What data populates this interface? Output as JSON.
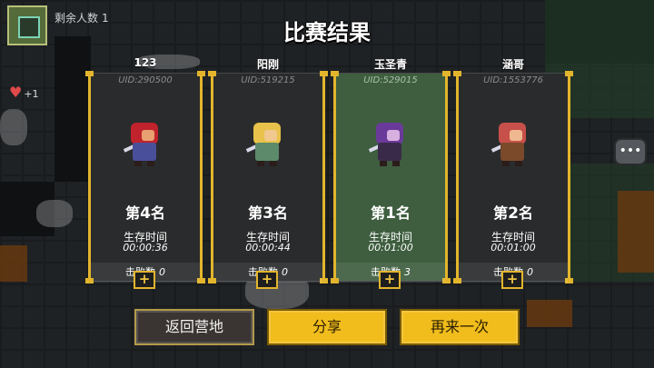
{
  "hud": {
    "remaining_label": "剩余人数",
    "remaining_count": "1",
    "heart_value": "+1",
    "chat_icon": "chat-bubble-icon"
  },
  "title": "比赛结果",
  "players": [
    {
      "name": "123",
      "uid": "UID:290500",
      "rank_prefix": "第",
      "rank": "4",
      "rank_suffix": "名",
      "survival_label": "生存时间",
      "survival_time": "00:00:36",
      "kills_label": "击败数",
      "kills": "0",
      "winner": false,
      "colors": {
        "head": "#c0232b",
        "face": "#e8a070",
        "body": "#4a4f9a"
      }
    },
    {
      "name": "阳刚",
      "uid": "UID:519215",
      "rank_prefix": "第",
      "rank": "3",
      "rank_suffix": "名",
      "survival_label": "生存时间",
      "survival_time": "00:00:44",
      "kills_label": "击败数",
      "kills": "0",
      "winner": false,
      "colors": {
        "head": "#e8c24a",
        "face": "#f0c890",
        "body": "#5c8a6a"
      }
    },
    {
      "name": "玉圣青",
      "uid": "UID:529015",
      "rank_prefix": "第",
      "rank": "1",
      "rank_suffix": "名",
      "survival_label": "生存时间",
      "survival_time": "00:01:00",
      "kills_label": "击败数",
      "kills": "3",
      "winner": true,
      "colors": {
        "head": "#6a3a9a",
        "face": "#d8b0e0",
        "body": "#3a2a4a"
      }
    },
    {
      "name": "涵哥",
      "uid": "UID:1553776",
      "rank_prefix": "第",
      "rank": "2",
      "rank_suffix": "名",
      "survival_label": "生存时间",
      "survival_time": "00:01:00",
      "kills_label": "击败数",
      "kills": "0",
      "winner": false,
      "colors": {
        "head": "#c8504a",
        "face": "#f0b890",
        "body": "#7a4a2a"
      }
    }
  ],
  "add_button": "+",
  "buttons": {
    "back": "返回营地",
    "share": "分享",
    "again": "再来一次"
  },
  "accent": "#e2b52c"
}
